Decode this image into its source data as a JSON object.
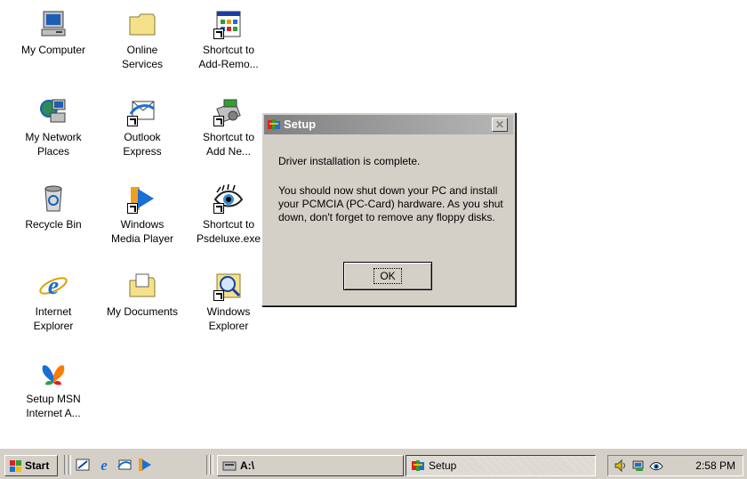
{
  "desktop": {
    "icons": [
      {
        "label": "My Computer"
      },
      {
        "label": "Online\nServices"
      },
      {
        "label": "Shortcut to\nAdd-Remo..."
      },
      {
        "label": "My Network\nPlaces"
      },
      {
        "label": "Outlook\nExpress"
      },
      {
        "label": "Shortcut to\nAdd Ne..."
      },
      {
        "label": "Recycle Bin"
      },
      {
        "label": "Windows\nMedia Player"
      },
      {
        "label": "Shortcut to\nPsdeluxe.exe"
      },
      {
        "label": "Internet\nExplorer"
      },
      {
        "label": "My Documents"
      },
      {
        "label": "Windows\nExplorer"
      },
      {
        "label": "Setup MSN\nInternet A..."
      }
    ]
  },
  "dialog": {
    "title": "Setup",
    "close_symbol": "✕",
    "message_line1": "Driver installation is complete.",
    "message_body": "You should now shut down your PC and install your PCMCIA (PC-Card) hardware. As you shut down, don't forget to remove any floppy disks.",
    "ok_label": "OK"
  },
  "taskbar": {
    "start_label": "Start",
    "tasks": [
      {
        "label": "A:\\"
      },
      {
        "label": "Setup"
      }
    ],
    "clock": "2:58 PM",
    "quick_launch": [
      "show-desktop-icon",
      "internet-explorer-icon",
      "outlook-express-icon",
      "media-player-icon"
    ]
  }
}
